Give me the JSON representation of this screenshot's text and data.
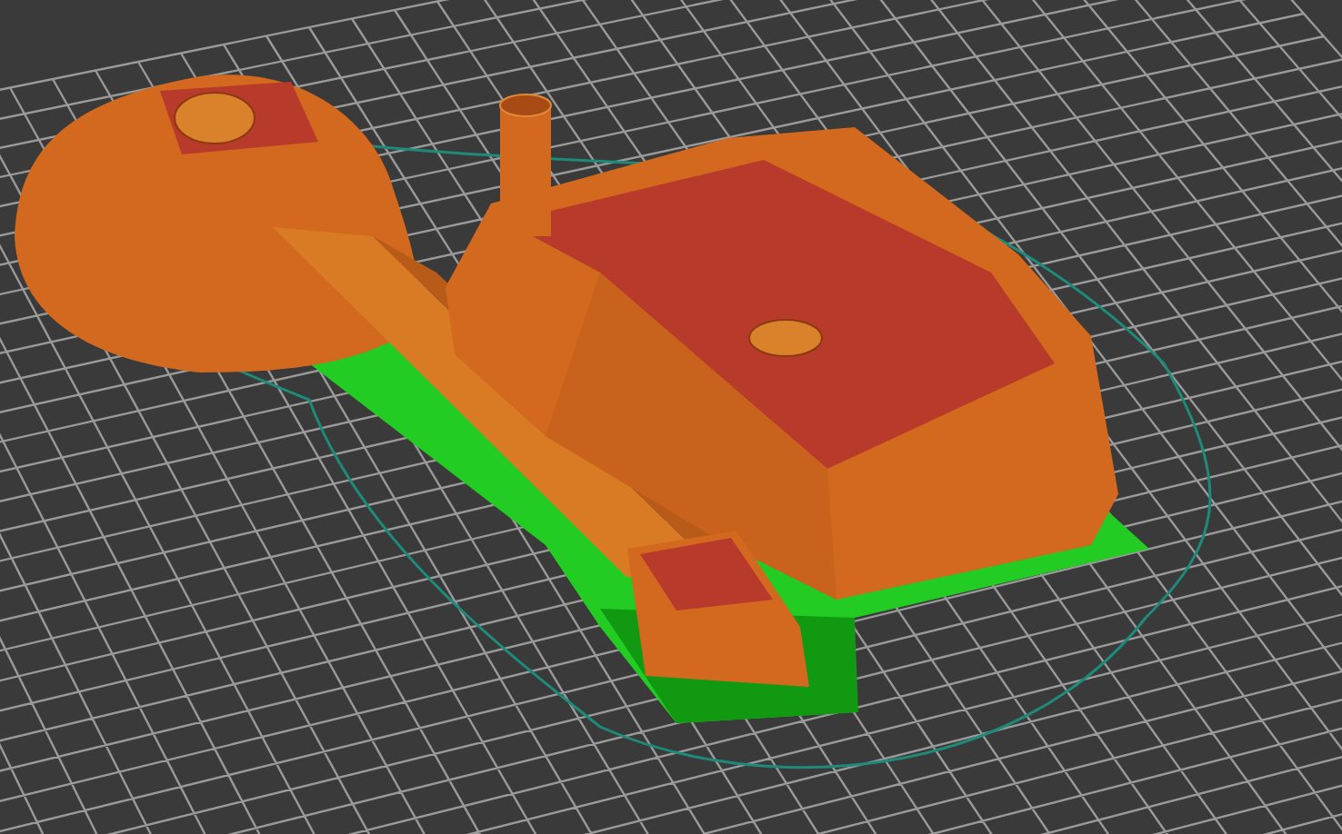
{
  "preview": {
    "kind": "sliced-model"
  }
}
